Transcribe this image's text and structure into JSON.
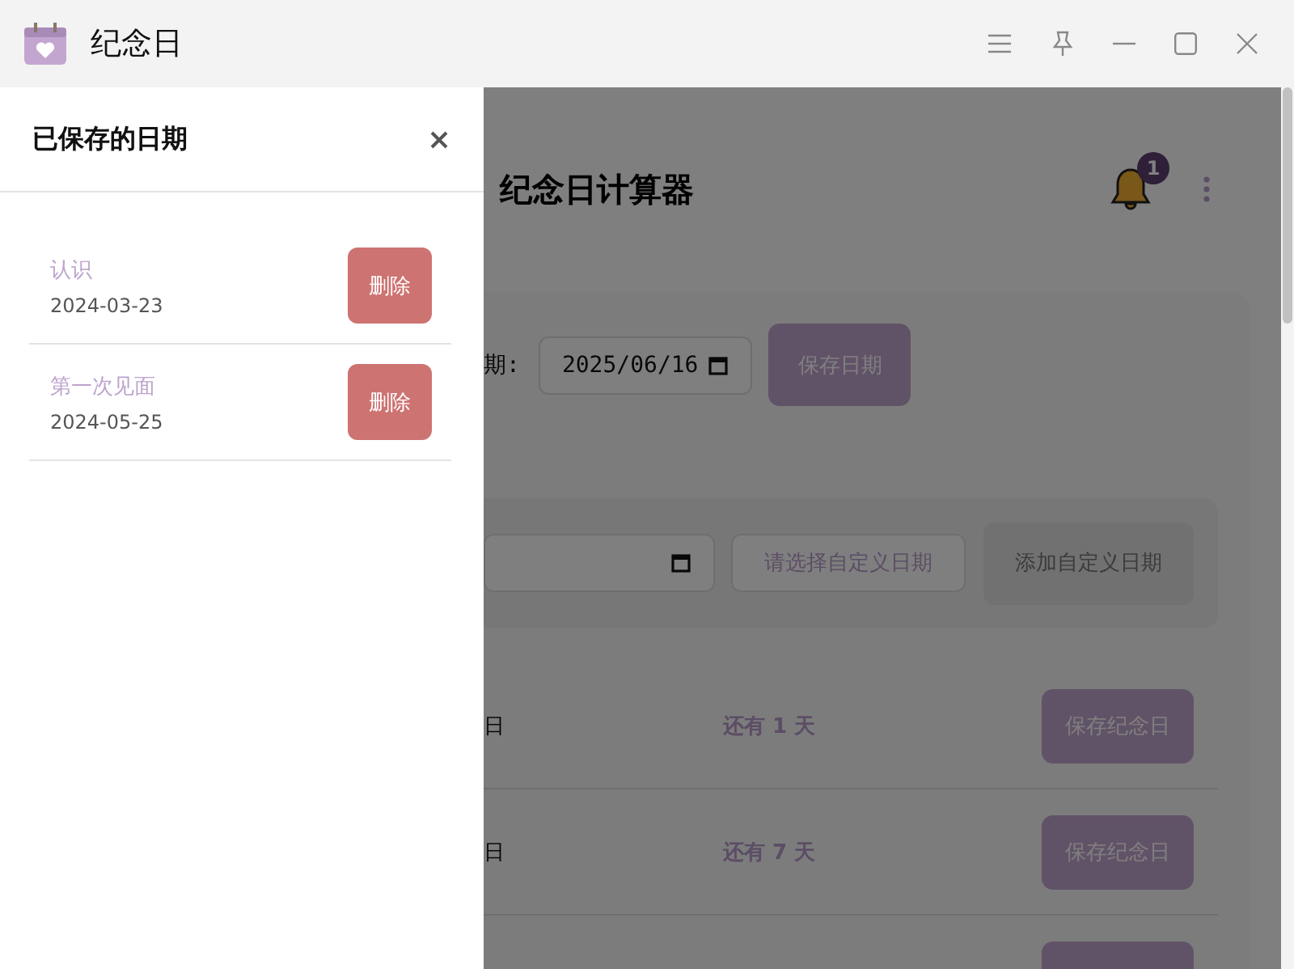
{
  "window": {
    "title": "纪念日"
  },
  "drawer": {
    "title": "已保存的日期",
    "items": [
      {
        "name": "认识",
        "date": "2024-03-23",
        "action": "删除"
      },
      {
        "name": "第一次见面",
        "date": "2024-05-25",
        "action": "删除"
      }
    ]
  },
  "main": {
    "title": "纪念日计算器",
    "notification_count": "1",
    "date_label": "期:",
    "date_value": "2025/06/16",
    "save_date_button": "保存日期",
    "custom": {
      "placeholder": "请选择自定义日期",
      "add_button": "添加自定义日期"
    },
    "anniversaries": [
      {
        "label": "日",
        "countdown": "还有 1 天",
        "action": "保存纪念日"
      },
      {
        "label": "日",
        "countdown": "还有 7 天",
        "action": "保存纪念日"
      }
    ]
  }
}
